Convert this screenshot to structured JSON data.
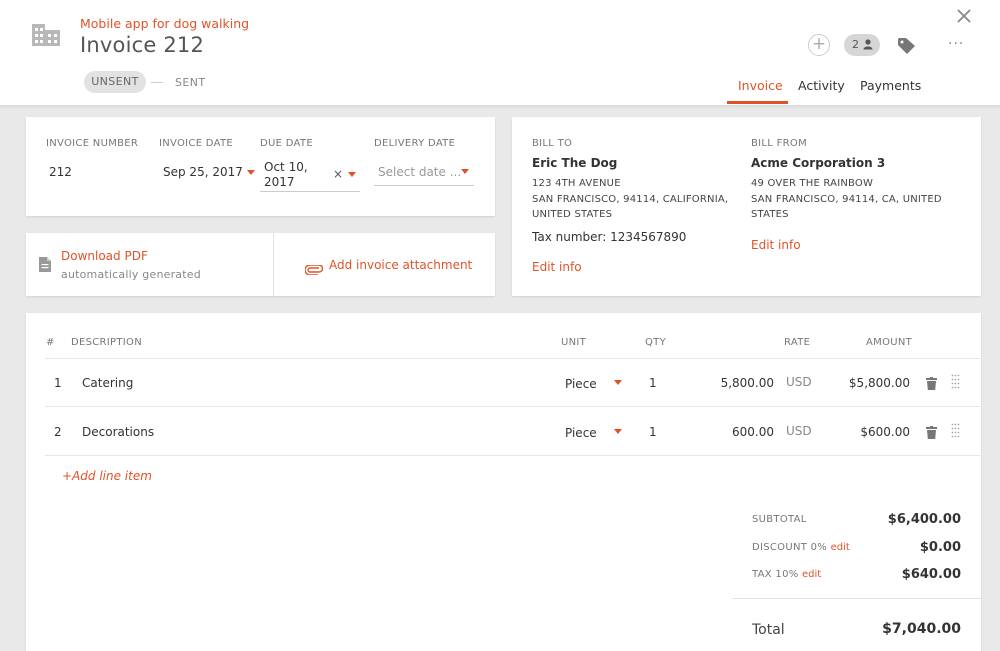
{
  "header": {
    "project": "Mobile app for dog walking",
    "title": "Invoice 212",
    "status_unsent": "UNSENT",
    "status_sent": "SENT",
    "people_count": "2",
    "tabs": [
      {
        "label": "Invoice",
        "active": true
      },
      {
        "label": "Activity",
        "active": false
      },
      {
        "label": "Payments",
        "active": false
      }
    ]
  },
  "details": {
    "invoice_number_label": "INVOICE NUMBER",
    "invoice_number": "212",
    "invoice_date_label": "INVOICE DATE",
    "invoice_date": "Sep 25, 2017",
    "due_date_label": "DUE DATE",
    "due_date_line1": "Oct 10,",
    "due_date_line2": "2017",
    "delivery_date_label": "DELIVERY DATE",
    "delivery_date_placeholder": "Select date ..."
  },
  "attachments": {
    "download_label": "Download PDF",
    "download_sub": "automatically generated",
    "add_attachment": "Add invoice attachment"
  },
  "bill_to": {
    "label": "BILL TO",
    "name": "Eric The Dog",
    "address1": "123 4TH AVENUE",
    "address2": "SAN FRANCISCO, 94114, CALIFORNIA,",
    "address3": "UNITED STATES",
    "tax": "Tax number: 1234567890",
    "edit": "Edit info"
  },
  "bill_from": {
    "label": "BILL FROM",
    "name": "Acme Corporation 3",
    "address1": "49 OVER THE RAINBOW",
    "address2": "SAN FRANCISCO, 94114, CA, UNITED",
    "address3": "STATES",
    "edit": "Edit info"
  },
  "table": {
    "headers": {
      "num": "#",
      "description": "DESCRIPTION",
      "unit": "UNIT",
      "qty": "QTY",
      "rate": "RATE",
      "amount": "AMOUNT"
    },
    "rows": [
      {
        "num": "1",
        "description": "Catering",
        "unit": "Piece",
        "qty": "1",
        "rate": "5,800.00",
        "currency": "USD",
        "amount": "$5,800.00"
      },
      {
        "num": "2",
        "description": "Decorations",
        "unit": "Piece",
        "qty": "1",
        "rate": "600.00",
        "currency": "USD",
        "amount": "$600.00"
      }
    ],
    "add_line": "+Add line item"
  },
  "totals": {
    "subtotal_label": "SUBTOTAL",
    "subtotal": "$6,400.00",
    "discount_label": "DISCOUNT 0%",
    "discount": "$0.00",
    "tax_label": "TAX 10%",
    "tax": "$640.00",
    "edit": "edit",
    "total_label": "Total",
    "total": "$7,040.00"
  },
  "colors": {
    "accent": "#e0532a",
    "background": "#e9e9ea"
  }
}
